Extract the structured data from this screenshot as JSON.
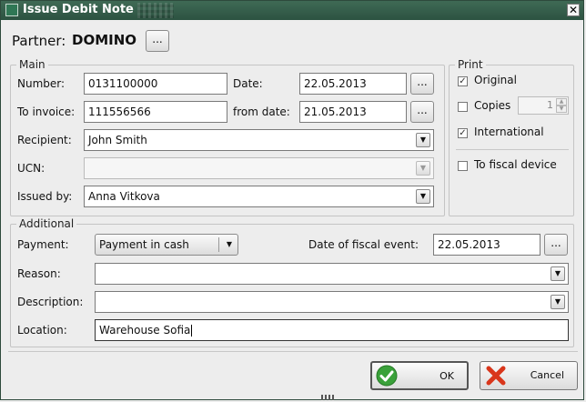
{
  "window": {
    "title": "Issue Debit Note"
  },
  "partner": {
    "label": "Partner:",
    "name": "DOMINO",
    "browse_label": "..."
  },
  "main": {
    "legend": "Main",
    "number_label": "Number:",
    "number_value": "0131100000",
    "date_label": "Date:",
    "date_value": "22.05.2013",
    "date_btn": "...",
    "invoice_label": "To invoice:",
    "invoice_value": "111556566",
    "from_date_label": "from date:",
    "from_date_value": "21.05.2013",
    "from_date_btn": "...",
    "recipient_label": "Recipient:",
    "recipient_value": "John Smith",
    "ucn_label": "UCN:",
    "ucn_value": "",
    "issued_by_label": "Issued by:",
    "issued_by_value": "Anna Vitkova"
  },
  "print": {
    "legend": "Print",
    "original_label": "Original",
    "original_checked": true,
    "copies_label": "Copies",
    "copies_checked": false,
    "copies_value": "1",
    "international_label": "International",
    "international_checked": true,
    "fiscal_label": "To fiscal device",
    "fiscal_checked": false
  },
  "additional": {
    "legend": "Additional",
    "payment_label": "Payment:",
    "payment_value": "Payment in cash",
    "fiscal_event_label": "Date of fiscal event:",
    "fiscal_event_value": "22.05.2013",
    "fiscal_event_btn": "...",
    "reason_label": "Reason:",
    "reason_value": "",
    "description_label": "Description:",
    "description_value": "",
    "location_label": "Location:",
    "location_value": "Warehouse Sofia"
  },
  "buttons": {
    "ok_label": "OK",
    "cancel_label": "Cancel"
  },
  "icons": {
    "ok": "check-icon",
    "cancel": "x-icon",
    "close": "close-icon",
    "dropdown": "chevron-down-icon",
    "app": "window-icon"
  },
  "colors": {
    "titlebar": "#2c5241",
    "ok_icon": "#3aa13a",
    "cancel_icon": "#d9361b"
  }
}
